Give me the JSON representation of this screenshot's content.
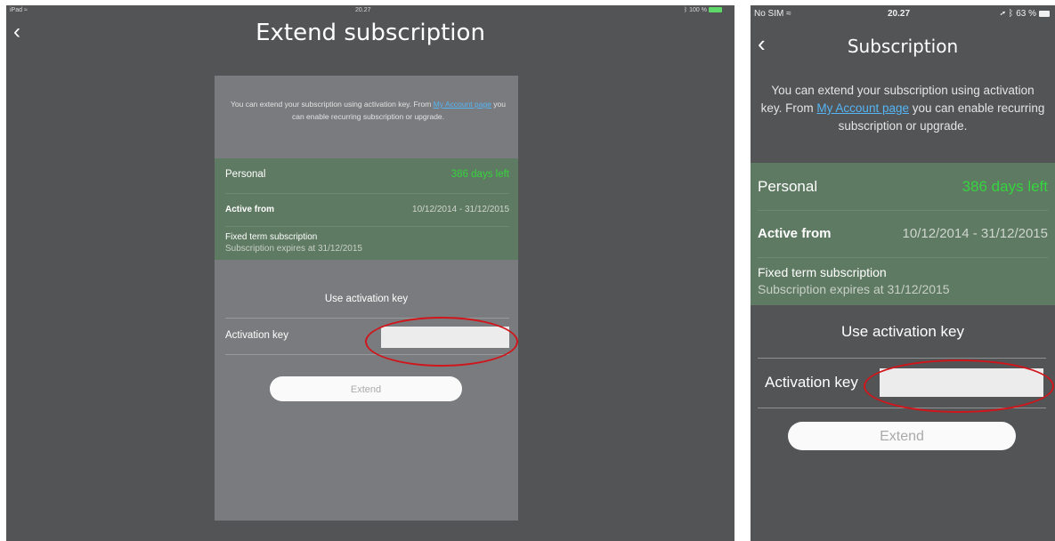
{
  "ipad": {
    "status": {
      "carrier": "iPad",
      "time": "20.27",
      "battery": "100 %"
    },
    "title": "Extend subscription",
    "info": {
      "before": "You can extend your subscription using activation key. From ",
      "link": "My Account page",
      "after": " you can enable recurring subscription or upgrade."
    },
    "plan": {
      "name": "Personal",
      "days_left": "386 days left",
      "active_label": "Active from",
      "active_range": "10/12/2014 - 31/12/2015",
      "type": "Fixed term subscription",
      "expires": "Subscription expires at 31/12/2015"
    },
    "use_key_heading": "Use activation key",
    "activation_label": "Activation key",
    "activation_value": "",
    "extend_label": "Extend"
  },
  "phone": {
    "status": {
      "carrier": "No SIM",
      "time": "20.27",
      "battery": "63 %"
    },
    "title": "Subscription",
    "info": {
      "before": "You can extend your subscription using activation key. From ",
      "link": "My Account page",
      "after": " you can enable recurring subscription or upgrade."
    },
    "plan": {
      "name": "Personal",
      "days_left": "386 days left",
      "active_label": "Active from",
      "active_range": "10/12/2014 - 31/12/2015",
      "type": "Fixed term subscription",
      "expires": "Subscription expires at 31/12/2015"
    },
    "use_key_heading": "Use activation key",
    "activation_label": "Activation key",
    "activation_value": "",
    "extend_label": "Extend"
  },
  "colors": {
    "background": "#535456",
    "plan_green": "#5e7a62",
    "days_left": "#36d43f",
    "link": "#55b5f5",
    "highlight": "#d0151b"
  }
}
